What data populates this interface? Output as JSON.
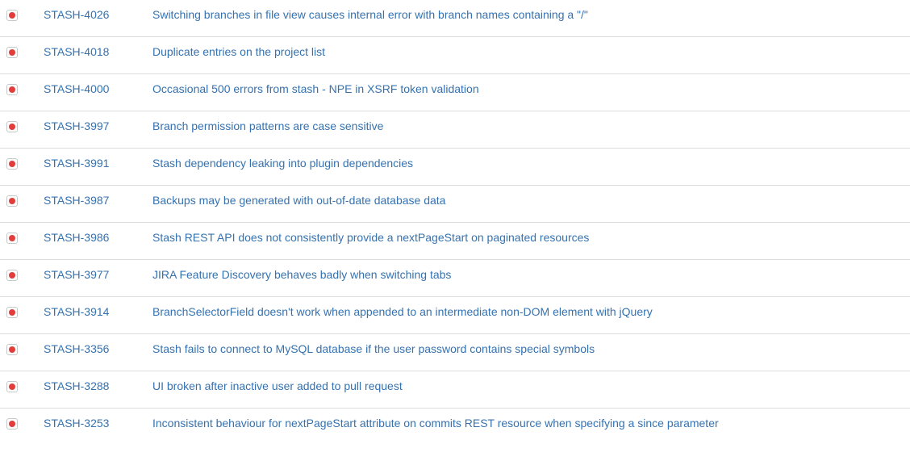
{
  "issues": [
    {
      "key": "STASH-4026",
      "summary": "Switching branches in file view causes internal error with branch names containing a \"/\"",
      "icon": "bug-icon"
    },
    {
      "key": "STASH-4018",
      "summary": "Duplicate entries on the project list",
      "icon": "bug-icon"
    },
    {
      "key": "STASH-4000",
      "summary": "Occasional 500 errors from stash - NPE in XSRF token validation",
      "icon": "bug-icon"
    },
    {
      "key": "STASH-3997",
      "summary": "Branch permission patterns are case sensitive",
      "icon": "bug-icon"
    },
    {
      "key": "STASH-3991",
      "summary": "Stash dependency leaking into plugin dependencies",
      "icon": "bug-icon"
    },
    {
      "key": "STASH-3987",
      "summary": "Backups may be generated with out-of-date database data",
      "icon": "bug-icon"
    },
    {
      "key": "STASH-3986",
      "summary": "Stash REST API does not consistently provide a nextPageStart on paginated resources",
      "icon": "bug-icon"
    },
    {
      "key": "STASH-3977",
      "summary": "JIRA Feature Discovery behaves badly when switching tabs",
      "icon": "bug-icon"
    },
    {
      "key": "STASH-3914",
      "summary": "BranchSelectorField doesn't work when appended to an intermediate non-DOM element with jQuery",
      "icon": "bug-icon"
    },
    {
      "key": "STASH-3356",
      "summary": "Stash fails to connect to MySQL database if the user password contains special symbols",
      "icon": "bug-icon"
    },
    {
      "key": "STASH-3288",
      "summary": "UI broken after inactive user added to pull request",
      "icon": "bug-icon"
    },
    {
      "key": "STASH-3253",
      "summary": "Inconsistent behaviour for nextPageStart attribute on commits REST resource when specifying a since parameter",
      "icon": "bug-icon"
    }
  ],
  "colors": {
    "link": "#3572b0",
    "bug_dot": "#e23d3d",
    "row_divider": "#dcdcdc"
  }
}
